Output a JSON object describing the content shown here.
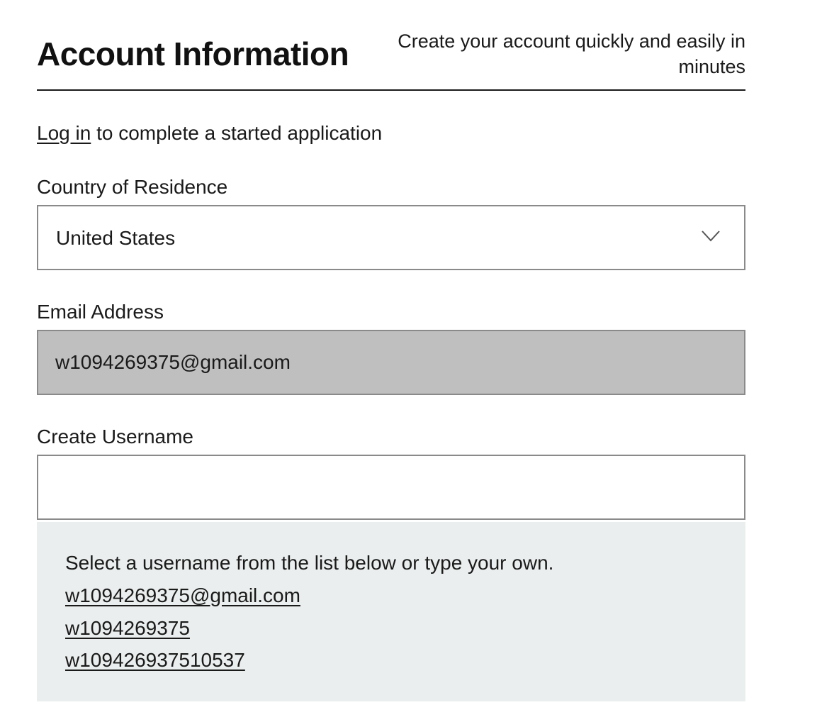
{
  "header": {
    "title": "Account Information",
    "tagline": "Create your account quickly and easily in minutes"
  },
  "login_prompt": {
    "link_text": "Log in",
    "rest_text": " to complete a started application"
  },
  "country_field": {
    "label": "Country of Residence",
    "value": "United States",
    "icon": "chevron-down-icon"
  },
  "email_field": {
    "label": "Email Address",
    "value": "w1094269375@gmail.com",
    "disabled": true
  },
  "username_field": {
    "label": "Create Username",
    "value": ""
  },
  "username_suggestions": {
    "intro": "Select a username from the list below or type your own.",
    "items": [
      "w1094269375@gmail.com",
      "w1094269375",
      "w109426937510537"
    ]
  },
  "colors": {
    "text": "#1a1a1a",
    "field_border": "#8a8a8a",
    "disabled_field_bg": "#bfbfbf",
    "suggestion_panel_bg": "#ebeeee"
  }
}
